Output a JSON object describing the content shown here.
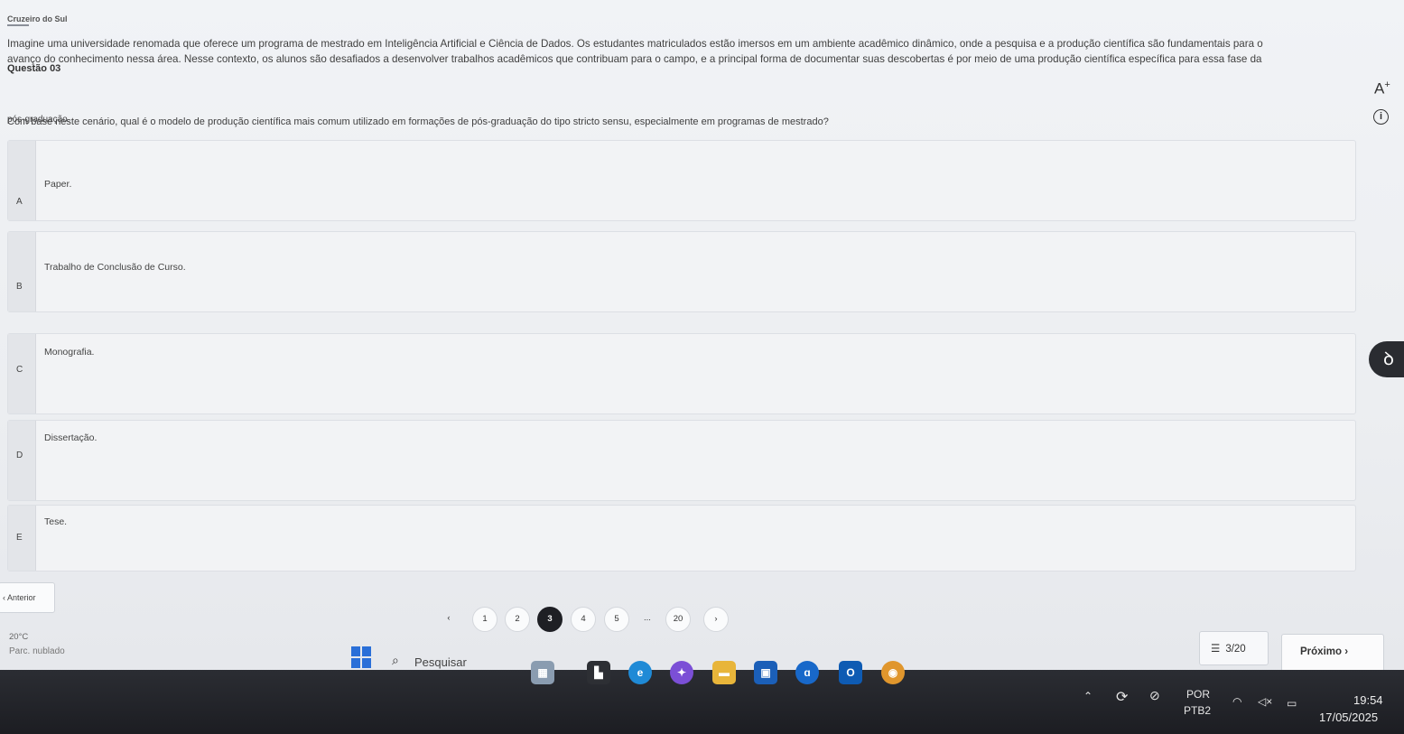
{
  "header": {
    "logo_text": "Cruzeiro do Sul",
    "question_number": "Questão 03"
  },
  "question": {
    "statement_line1": "Imagine uma universidade renomada que oferece um programa de mestrado em Inteligência Artificial e Ciência de Dados. Os estudantes matriculados estão imersos em um ambiente acadêmico dinâmico, onde a pesquisa e a produção científica são fundamentais para o",
    "statement_line2": "avanço do conhecimento nessa área. Nesse contexto, os alunos são desafiados a desenvolver trabalhos acadêmicos que contribuam para o campo, e a principal forma de documentar suas descobertas é por meio de uma produção científica específica para essa fase da",
    "statement_line3": "pós-graduação.",
    "prompt": "Com base neste cenário, qual é o modelo de produção científica mais comum utilizado em formações de pós-graduação do tipo stricto sensu, especialmente em programas de mestrado?"
  },
  "tools": {
    "font_size_label": "A",
    "font_size_sup": "+",
    "info_label": "i"
  },
  "options": [
    {
      "letter": "A",
      "text": "Paper."
    },
    {
      "letter": "B",
      "text": "Trabalho de Conclusão de Curso."
    },
    {
      "letter": "C",
      "text": "Monografia."
    },
    {
      "letter": "D",
      "text": "Dissertação."
    },
    {
      "letter": "E",
      "text": "Tese."
    }
  ],
  "navigation": {
    "prev_label": "‹ Anterior",
    "next_label": "Próximo  ›",
    "counter": "3/20",
    "counter_icon": "list-icon",
    "pages": [
      "‹",
      "1",
      "2",
      "3",
      "4",
      "5",
      "...",
      "20",
      "›"
    ],
    "active_page": "3"
  },
  "weather": {
    "temperature": "20°C",
    "description": "Parc. nublado"
  },
  "taskbar": {
    "search_placeholder": "Pesquisar",
    "language": "POR",
    "layout": "PTB2",
    "time": "19:54",
    "date": "17/05/2025"
  },
  "colors": {
    "accent_active_page": "#1e1f24",
    "windows_blue": "#2a6fd8"
  }
}
